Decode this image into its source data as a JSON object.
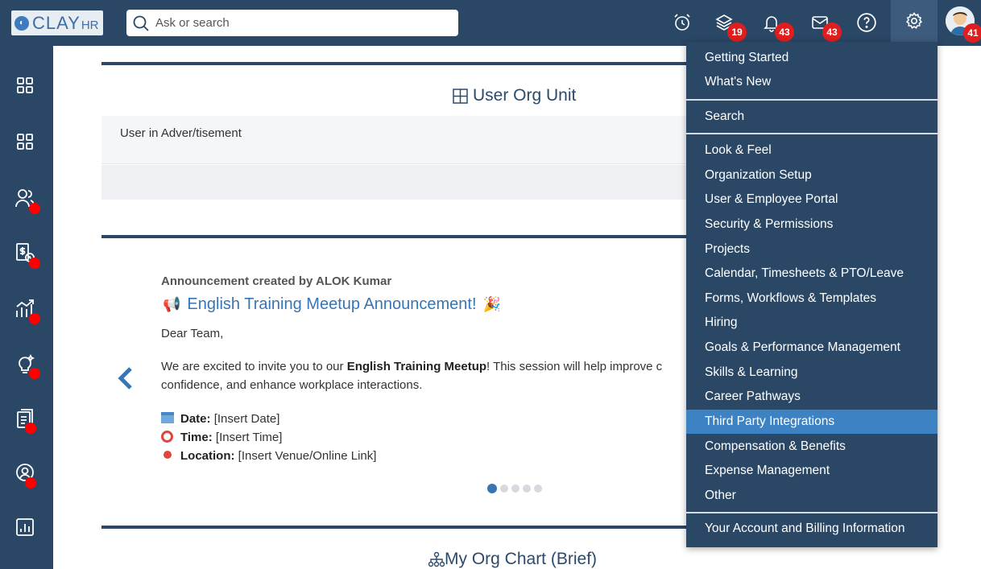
{
  "header": {
    "logo_text": "CLAY",
    "logo_sub": "HR",
    "search_placeholder": "Ask or search",
    "badges": {
      "layers": "19",
      "notifications": "43",
      "messages": "43",
      "avatar": "41"
    }
  },
  "cards": {
    "org_unit_title": "User Org Unit",
    "org_unit_row": "User in Adver/tisement",
    "org_chart_title": "My Org Chart (Brief)"
  },
  "announcement": {
    "author": "Announcement created by ALOK Kumar",
    "title": "English Training Meetup Announcement!",
    "greeting": "Dear Team,",
    "body_pre": "We are excited to invite you to our ",
    "body_bold": "English Training Meetup",
    "body_post": "! This session will help improve c",
    "body_line2": "confidence, and enhance workplace interactions.",
    "date_label": "Date:",
    "date_value": "[Insert Date]",
    "time_label": "Time:",
    "time_value": "[Insert Time]",
    "location_label": "Location:",
    "location_value": "[Insert Venue/Online Link]",
    "slide_count": 5,
    "active_slide": 1
  },
  "settings_menu": {
    "items": [
      "Getting Started",
      "What's New",
      "Search",
      "Look & Feel",
      "Organization Setup",
      "User & Employee Portal",
      "Security & Permissions",
      "Projects",
      "Calendar, Timesheets & PTO/Leave",
      "Forms, Workflows & Templates",
      "Hiring",
      "Goals & Performance Management",
      "Skills & Learning",
      "Career Pathways",
      "Third Party Integrations",
      "Compensation & Benefits",
      "Expense Management",
      "Other",
      "Your Account and Billing Information"
    ],
    "active_item": "Third Party Integrations"
  },
  "colors": {
    "nav_bg": "#2a4766",
    "accent": "#3775b4",
    "menu_active": "#3d82c2",
    "badge": "#e01e1e"
  }
}
